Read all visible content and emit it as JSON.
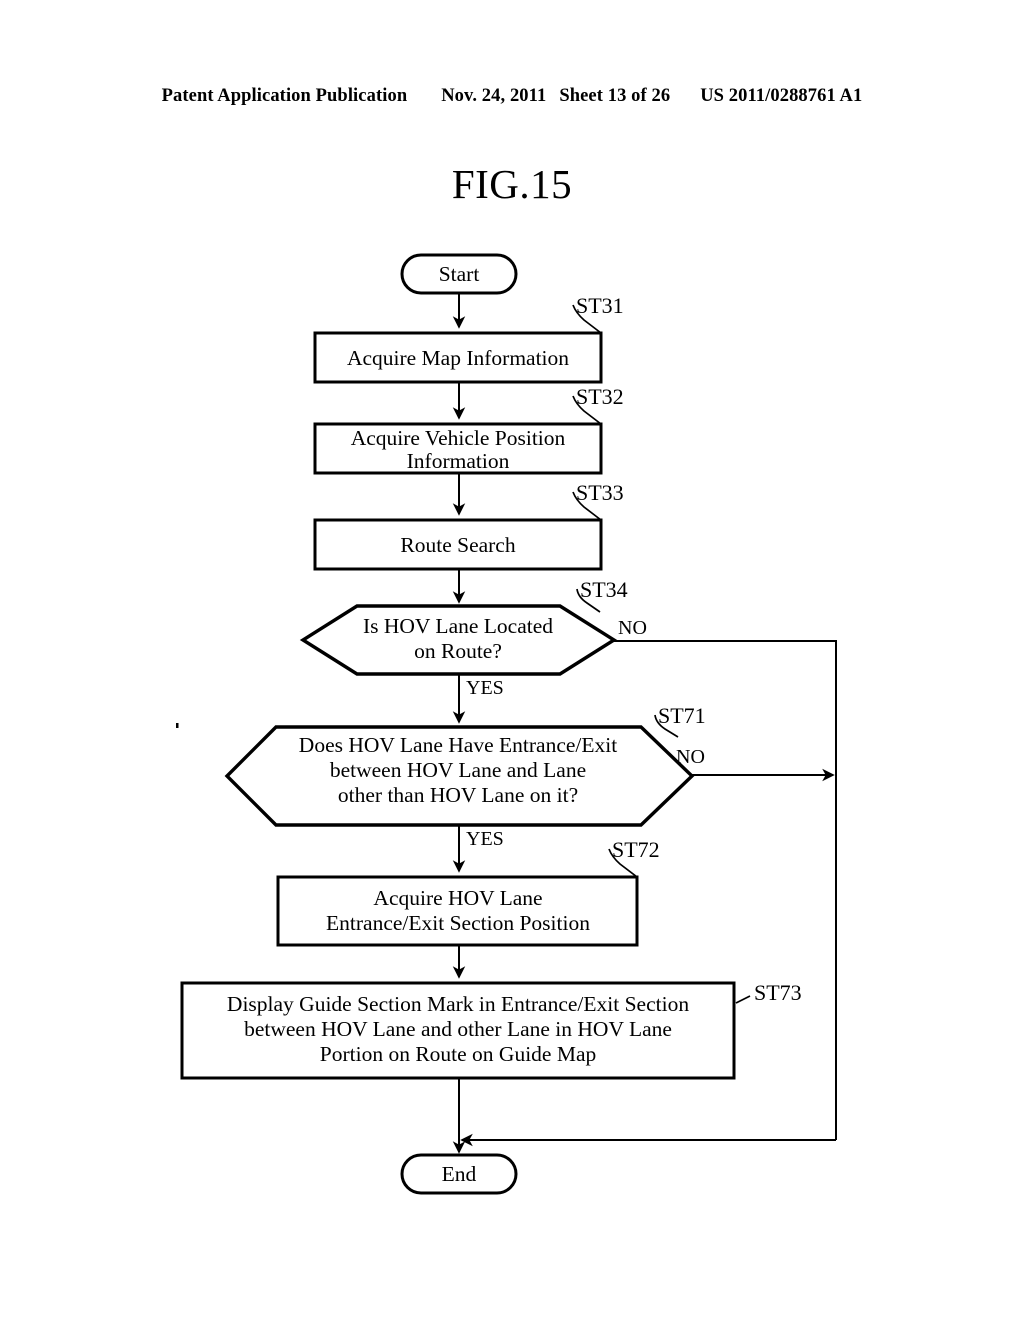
{
  "header": {
    "publication": "Patent Application Publication",
    "date": "Nov. 24, 2011",
    "sheet": "Sheet 13 of 26",
    "patent_number": "US 2011/0288761 A1"
  },
  "figure": {
    "title": "FIG.15",
    "type": "flowchart"
  },
  "flowchart": {
    "start_label": "Start",
    "end_label": "End",
    "nodes": [
      {
        "id": "start",
        "shape": "terminator",
        "label": "Start",
        "step": ""
      },
      {
        "id": "st31",
        "shape": "process",
        "label": "Acquire Map Information",
        "step": "ST31"
      },
      {
        "id": "st32",
        "shape": "process",
        "label": "Acquire Vehicle Position\nInformation",
        "step": "ST32"
      },
      {
        "id": "st33",
        "shape": "process",
        "label": "Route Search",
        "step": "ST33"
      },
      {
        "id": "st34",
        "shape": "decision",
        "label": "Is HOV Lane Located\non Route?",
        "step": "ST34"
      },
      {
        "id": "st71",
        "shape": "decision",
        "label": "Does HOV Lane Have Entrance/Exit\nbetween HOV Lane and Lane\nother than HOV Lane on it?",
        "step": "ST71"
      },
      {
        "id": "st72",
        "shape": "process",
        "label": "Acquire HOV Lane\nEntrance/Exit Section Position",
        "step": "ST72"
      },
      {
        "id": "st73",
        "shape": "process",
        "label": "Display Guide Section Mark in Entrance/Exit Section\nbetween HOV Lane and other Lane in HOV Lane\nPortion on Route on Guide Map",
        "step": "ST73"
      },
      {
        "id": "end",
        "shape": "terminator",
        "label": "End",
        "step": ""
      }
    ],
    "node_lines": {
      "st31": [
        "Acquire Map Information"
      ],
      "st32": [
        "Acquire Vehicle Position",
        "Information"
      ],
      "st33": [
        "Route Search"
      ],
      "st34": [
        "Is HOV Lane Located",
        "on Route?"
      ],
      "st71": [
        "Does HOV Lane Have Entrance/Exit",
        "between HOV Lane and Lane",
        "other than HOV Lane on it?"
      ],
      "st72": [
        "Acquire HOV Lane",
        "Entrance/Exit Section Position"
      ],
      "st73": [
        "Display Guide Section Mark in Entrance/Exit Section",
        "between HOV Lane and other Lane in HOV Lane",
        "Portion on Route on Guide Map"
      ]
    },
    "step_ids": {
      "st31": "ST31",
      "st32": "ST32",
      "st33": "ST33",
      "st34": "ST34",
      "st71": "ST71",
      "st72": "ST72",
      "st73": "ST73"
    },
    "branch_labels": {
      "st34_no": "NO",
      "st34_yes": "YES",
      "st71_no": "NO",
      "st71_yes": "YES"
    },
    "colors": {
      "line": "#000000",
      "fill": "#ffffff",
      "text": "#000000"
    }
  }
}
